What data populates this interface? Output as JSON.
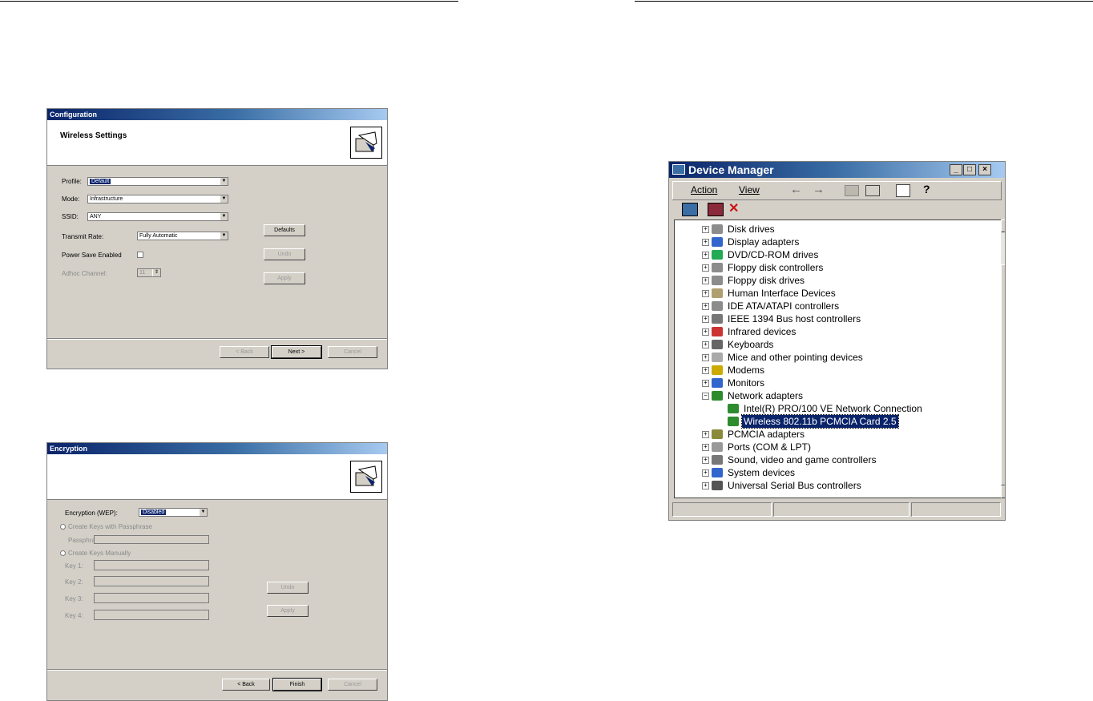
{
  "config_dialog": {
    "title": "Configuration",
    "heading": "Wireless Settings",
    "profile_label": "Profile:",
    "profile_value": "Default",
    "mode_label": "Mode:",
    "mode_value": "Infrastructure",
    "ssid_label": "SSID:",
    "ssid_value": "ANY",
    "transmit_label": "Transmit Rate:",
    "transmit_value": "Fully Automatic",
    "power_label": "Power Save Enabled",
    "adhoc_label": "Adhoc Channel:",
    "adhoc_value": "11",
    "defaults_button": "Defaults",
    "undo_button": "Undo",
    "apply_button": "Apply",
    "back_button": "< Back",
    "next_button": "Next >",
    "cancel_button": "Cancel"
  },
  "encryption_dialog": {
    "title": "Encryption",
    "encryption_label": "Encryption (WEP):",
    "encryption_value": "Disabled",
    "passphrase_radio": "Create Keys with Passphrase",
    "passphrase_label": "Passphrase:",
    "manual_radio": "Create Keys Manually",
    "key1_label": "Key 1:",
    "key2_label": "Key 2:",
    "key3_label": "Key 3:",
    "key4_label": "Key 4:",
    "undo_button": "Undo",
    "apply_button": "Apply",
    "back_button": "< Back",
    "finish_button": "Finish",
    "cancel_button": "Cancel"
  },
  "device_manager": {
    "title": "Device Manager",
    "menu": [
      "Action",
      "View"
    ],
    "minimize": "_",
    "maximize": "□",
    "close": "×",
    "tree": [
      {
        "label": "Disk drives",
        "icon": "disk-drive-icon",
        "color": "#8c8c8c",
        "expander": "+"
      },
      {
        "label": "Display adapters",
        "icon": "monitor-icon",
        "color": "#3366cc",
        "expander": "+"
      },
      {
        "label": "DVD/CD-ROM drives",
        "icon": "cdrom-icon",
        "color": "#22aa55",
        "expander": "+"
      },
      {
        "label": "Floppy disk controllers",
        "icon": "controller-icon",
        "color": "#8c8c8c",
        "expander": "+"
      },
      {
        "label": "Floppy disk drives",
        "icon": "floppy-drive-icon",
        "color": "#8c8c8c",
        "expander": "+"
      },
      {
        "label": "Human Interface Devices",
        "icon": "hid-icon",
        "color": "#b0a070",
        "expander": "+"
      },
      {
        "label": "IDE ATA/ATAPI controllers",
        "icon": "ide-controller-icon",
        "color": "#8c8c8c",
        "expander": "+"
      },
      {
        "label": "IEEE 1394 Bus host controllers",
        "icon": "firewire-icon",
        "color": "#777777",
        "expander": "+"
      },
      {
        "label": "Infrared devices",
        "icon": "infrared-icon",
        "color": "#cc3333",
        "expander": "+"
      },
      {
        "label": "Keyboards",
        "icon": "keyboard-icon",
        "color": "#666666",
        "expander": "+"
      },
      {
        "label": "Mice and other pointing devices",
        "icon": "mouse-icon",
        "color": "#aaaaaa",
        "expander": "+"
      },
      {
        "label": "Modems",
        "icon": "modem-icon",
        "color": "#ccaa00",
        "expander": "+"
      },
      {
        "label": "Monitors",
        "icon": "monitor-icon",
        "color": "#3366cc",
        "expander": "+"
      },
      {
        "label": "Network adapters",
        "icon": "network-card-icon",
        "color": "#2e8b2e",
        "expander": "−"
      },
      {
        "label": "Intel(R) PRO/100 VE Network Connection",
        "icon": "network-card-icon",
        "color": "#2e8b2e",
        "child": true
      },
      {
        "label": "Wireless 802.11b PCMCIA Card 2.5",
        "icon": "network-card-icon",
        "color": "#2e8b2e",
        "child": true,
        "selected": true
      },
      {
        "label": "PCMCIA adapters",
        "icon": "pcmcia-icon",
        "color": "#8a8a3a",
        "expander": "+"
      },
      {
        "label": "Ports (COM & LPT)",
        "icon": "port-icon",
        "color": "#999999",
        "expander": "+"
      },
      {
        "label": "Sound, video and game controllers",
        "icon": "speaker-icon",
        "color": "#777777",
        "expander": "+"
      },
      {
        "label": "System devices",
        "icon": "computer-icon",
        "color": "#3366cc",
        "expander": "+"
      },
      {
        "label": "Universal Serial Bus controllers",
        "icon": "usb-icon",
        "color": "#555555",
        "expander": "+"
      }
    ]
  }
}
